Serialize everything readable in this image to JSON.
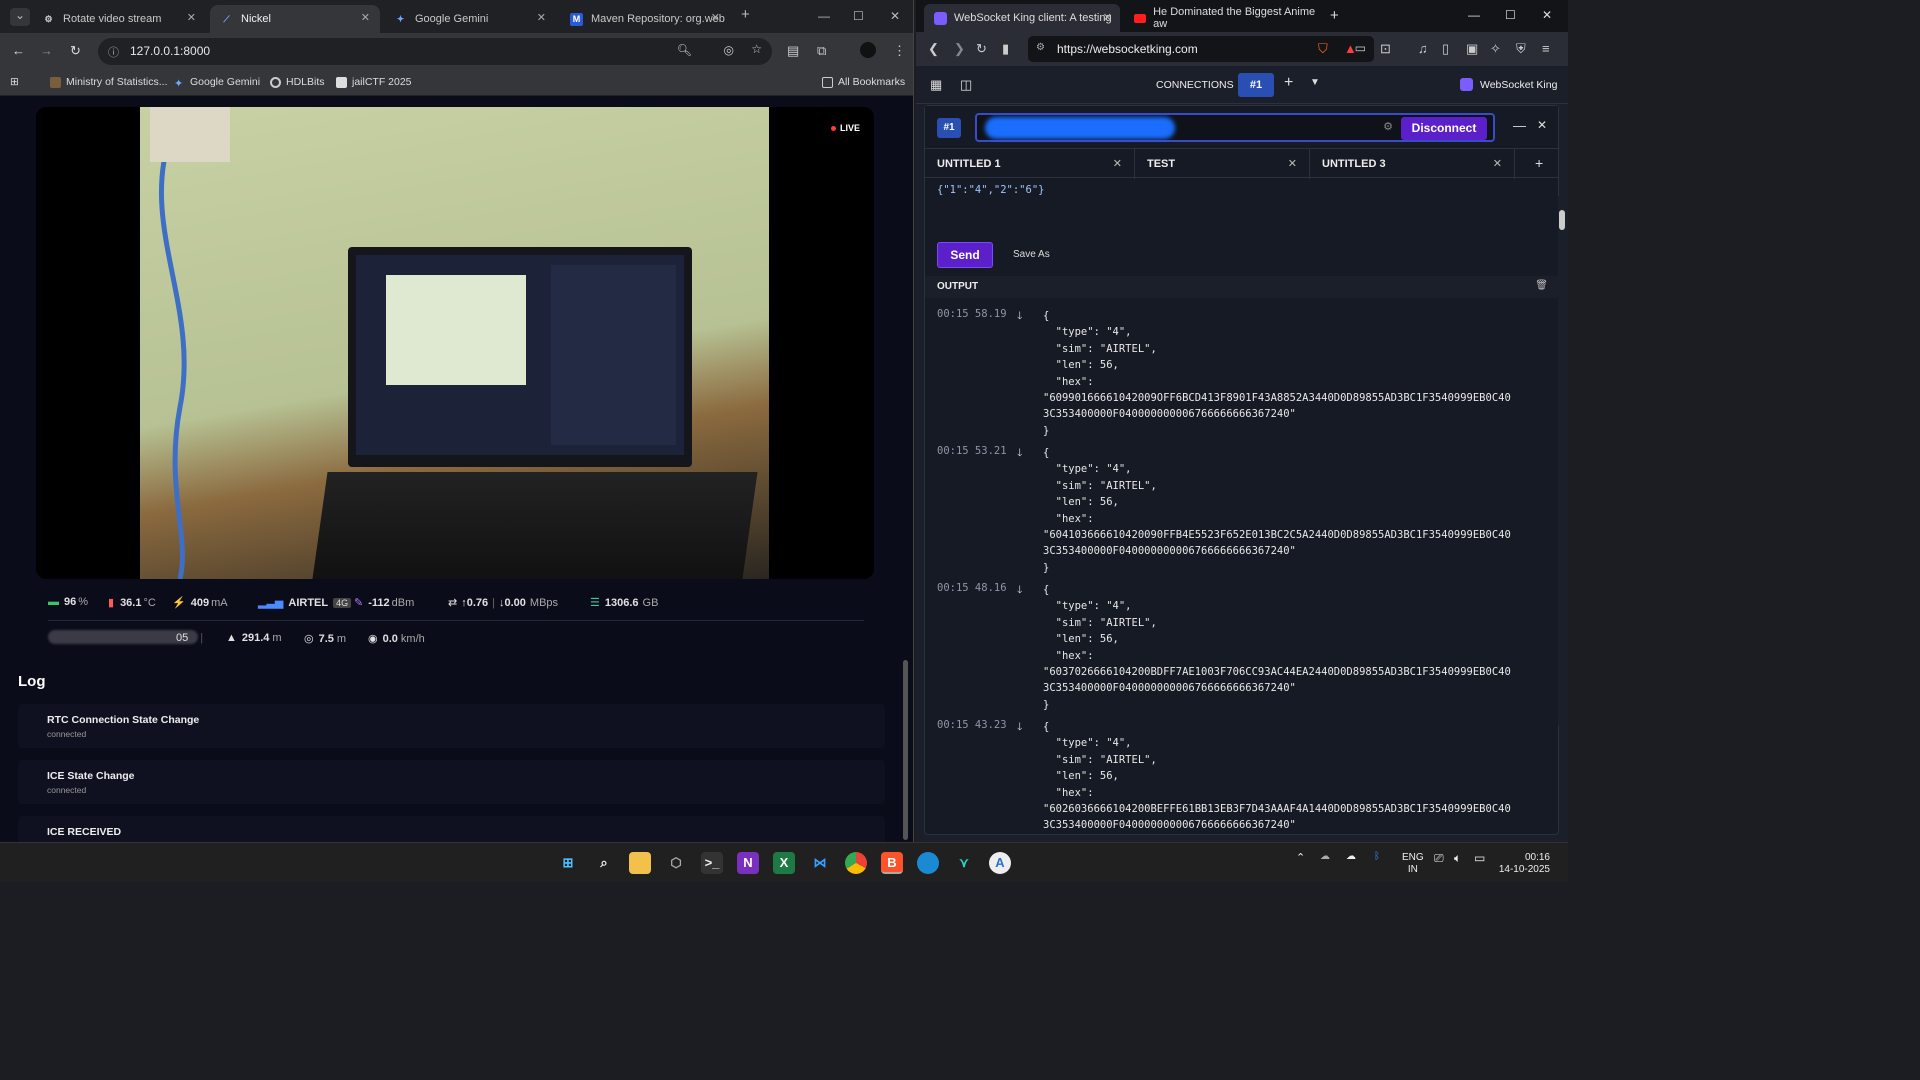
{
  "left_browser": {
    "tabs": [
      {
        "title": "Rotate video stream",
        "icon": "gear-icon"
      },
      {
        "title": "Nickel",
        "icon": "nickel-icon"
      },
      {
        "title": "Google Gemini",
        "icon": "gemini-icon"
      },
      {
        "title": "Maven Repository: org.web",
        "icon": "maven-icon"
      }
    ],
    "address": "127.0.0.1:8000",
    "bookmarks": [
      "Ministry of Statistics...",
      "Google Gemini",
      "HDLBits",
      "jailCTF 2025"
    ],
    "all_bookmarks_label": "All Bookmarks"
  },
  "stream": {
    "live_label": "LIVE",
    "stats": {
      "battery": "96",
      "battery_unit": "%",
      "temp": "36.1",
      "temp_unit": "°C",
      "current": "409",
      "current_unit": "mA",
      "carrier": "AIRTEL",
      "network": "4G",
      "signal": "-112",
      "signal_unit": "dBm",
      "up": "0.76",
      "down": "0.00",
      "rate_unit": "MBps",
      "data": "1306.6",
      "data_unit": "GB",
      "altitude": "291.4",
      "altitude_unit": "m",
      "accuracy": "7.5",
      "accuracy_unit": "m",
      "speed": "0.0",
      "speed_unit": "km/h",
      "coords_partial": "05"
    }
  },
  "log": {
    "title": "Log",
    "items": [
      {
        "title": "RTC Connection State Change",
        "sub": "connected"
      },
      {
        "title": "ICE State Change",
        "sub": "connected"
      },
      {
        "title": "ICE RECEIVED",
        "sub": ""
      }
    ]
  },
  "right_browser": {
    "tabs": [
      {
        "title": "WebSocket King client: A testing"
      },
      {
        "title": "He Dominated the Biggest Anime aw"
      }
    ],
    "address": "https://websocketking.com"
  },
  "wsk": {
    "connections_label": "CONNECTIONS",
    "conn_badge": "#1",
    "brand": "WebSocket King",
    "disconnect_label": "Disconnect",
    "editor_tabs": [
      "UNTITLED 1",
      "TEST",
      "UNTITLED 3"
    ],
    "editor_content": "{\"1\":\"4\",\"2\":\"6\"}",
    "send_label": "Send",
    "save_as_label": "Save As",
    "output_label": "OUTPUT",
    "messages": [
      {
        "time": "00:15 58.19",
        "body": "{\n  \"type\": \"4\",\n  \"sim\": \"AIRTEL\",\n  \"len\": 56,\n  \"hex\":\n\"60990166661042009OFF6BCD413F8901F43A8852A3440D0D89855AD3BC1F3540999EB0C40\n3C353400000F040000000006766666666367240\"\n}"
      },
      {
        "time": "00:15 53.21",
        "body": "{\n  \"type\": \"4\",\n  \"sim\": \"AIRTEL\",\n  \"len\": 56,\n  \"hex\":\n\"604103666610420090FFB4E5523F652E013BC2C5A2440D0D89855AD3BC1F3540999EB0C40\n3C353400000F040000000006766666666367240\"\n}"
      },
      {
        "time": "00:15 48.16",
        "body": "{\n  \"type\": \"4\",\n  \"sim\": \"AIRTEL\",\n  \"len\": 56,\n  \"hex\":\n\"6037026666104200BDFF7AE1003F706CC93AC44EA2440D0D89855AD3BC1F3540999EB0C40\n3C353400000F040000000006766666666367240\"\n}"
      },
      {
        "time": "00:15 43.23",
        "body": "{\n  \"type\": \"4\",\n  \"sim\": \"AIRTEL\",\n  \"len\": 56,\n  \"hex\":\n\"6026036666104200BEFFE61BB13EB3F7D43AAAF4A1440D0D89855AD3BC1F3540999EB0C40\n3C353400000F040000000006766666666367240\"\n}"
      }
    ]
  },
  "taskbar": {
    "lang": "ENG",
    "region": "IN",
    "time": "00:16",
    "date": "14-10-2025"
  },
  "colors": {
    "accent": "#5b20c9",
    "badge": "#2a4fb3"
  }
}
